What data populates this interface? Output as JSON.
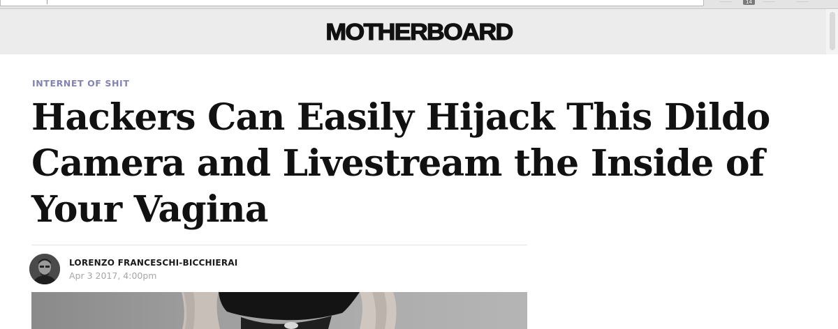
{
  "browser": {
    "tab_badge": "14"
  },
  "site": {
    "logo_text": "MOTHERBOARD"
  },
  "article": {
    "category": "INTERNET OF SHIT",
    "headline": "Hackers Can Easily Hijack This Dildo Camera and Livestream the Inside of Your Vagina",
    "author": "LORENZO FRANCESCHI-BICCHIERAI",
    "date": "Apr 3 2017, 4:00pm"
  },
  "colors": {
    "header_bg": "#ececec",
    "category": "#8383b3",
    "headline": "#111111",
    "date": "#a6a6a6"
  },
  "icons": {
    "avatar": "author-avatar"
  }
}
